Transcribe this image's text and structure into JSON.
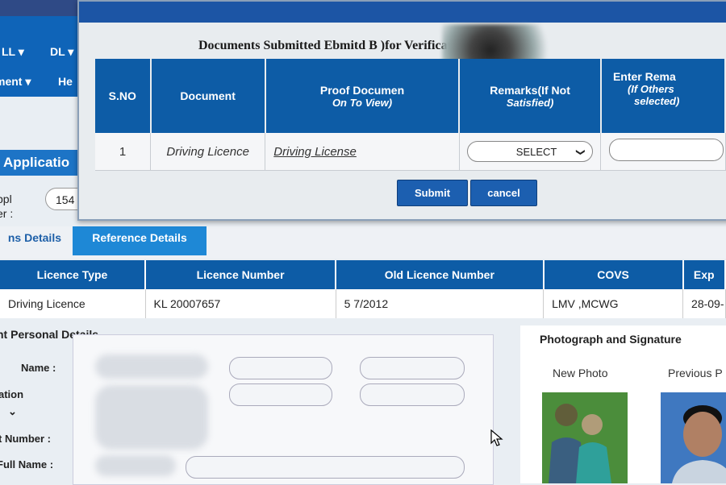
{
  "nav": {
    "item1": "LL",
    "item2": "DL",
    "item3": "ment",
    "item4": "He"
  },
  "app_header": "Applicatio",
  "application": {
    "label_line1": "ppl",
    "label_line2": "er :",
    "value": "154"
  },
  "tabs": [
    {
      "label": "ns Details"
    },
    {
      "label": "Reference Details"
    }
  ],
  "licence_table": {
    "headers": [
      "Licence Type",
      "Licence Number",
      "Old Licence Number",
      "COVS",
      "Exp"
    ],
    "row": [
      "Driving Licence",
      "KL      20007657",
      "5      7/2012",
      "LMV ,MCWG",
      "28-09-"
    ]
  },
  "personal": {
    "title": "nt Personal Details",
    "labels": [
      "Name :",
      "ation",
      "t Number :",
      "Full Name :"
    ]
  },
  "photo": {
    "title": "Photograph and Signature",
    "new_label": "New Photo",
    "previous_label": "Previous P"
  },
  "modal": {
    "heading": "Documents Submitted Ebmitd                    B )for Verificatio",
    "columns": [
      {
        "line1": "S.NO",
        "line2": ""
      },
      {
        "line1": "Document",
        "line2": ""
      },
      {
        "line1": "Proof Documen",
        "line2": "On To View)"
      },
      {
        "line1": "Remarks(If Not",
        "line2": "Satisfied)"
      },
      {
        "line1": "Enter Rema",
        "line2": "(If Others",
        "line3": "selected)"
      }
    ],
    "rows": [
      {
        "sno": "1",
        "document": "Driving Licence",
        "proof_link": "Driving License",
        "remarks_selected": "SELECT",
        "enter_remarks": ""
      }
    ],
    "submit_label": "Submit",
    "cancel_label": "cancel"
  },
  "colors": {
    "modal_header": "#1c55a5",
    "table_header": "#0d5ca6",
    "tab_active": "#1e88d6",
    "button": "#1c5fb0"
  }
}
